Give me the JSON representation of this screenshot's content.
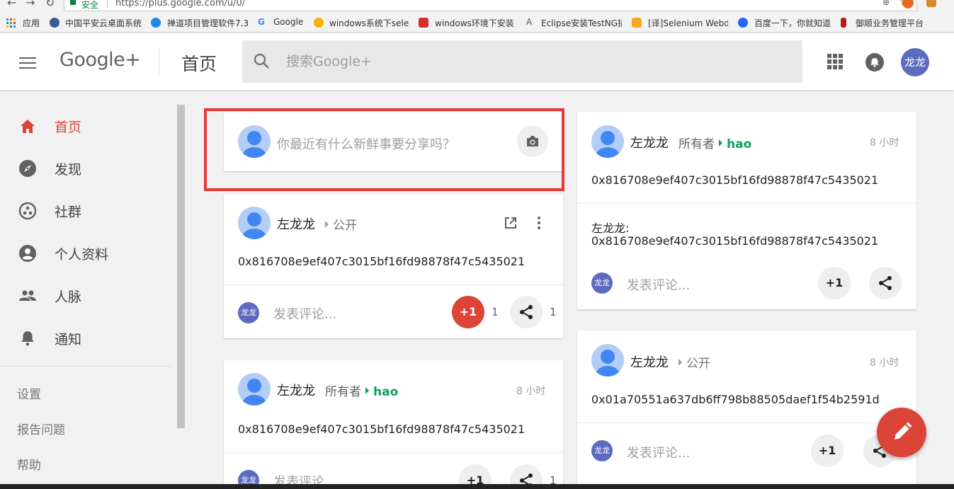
{
  "browser": {
    "secure_label": "安全",
    "url": "https://plus.google.com/u/0/",
    "bookmarks": [
      {
        "label": "应用",
        "color": "#4285f4"
      },
      {
        "label": "中国平安云桌面系统",
        "color": "#3b5998"
      },
      {
        "label": "禅道项目管理软件7.3",
        "color": "#1e88e5"
      },
      {
        "label": "Google",
        "color": "#4285f4"
      },
      {
        "label": "windows系统下selen",
        "color": "#f4b400"
      },
      {
        "label": "windows环境下安装",
        "color": "#d32f2f"
      },
      {
        "label": "Eclipse安装TestNG插",
        "color": "#555555"
      },
      {
        "label": "[译]Selenium Webd",
        "color": "#f9a825"
      },
      {
        "label": "百度一下，你就知道",
        "color": "#2962ff"
      },
      {
        "label": "御顺业务管理平台",
        "color": "#b71c1c"
      }
    ]
  },
  "header": {
    "logo": "Google+",
    "page_title": "首页",
    "search_placeholder": "搜索Google+",
    "avatar_text": "龙龙"
  },
  "sidebar": {
    "items": [
      {
        "label": "首页",
        "icon": "home-icon",
        "active": true
      },
      {
        "label": "发现",
        "icon": "compass-icon"
      },
      {
        "label": "社群",
        "icon": "communities-icon"
      },
      {
        "label": "个人资料",
        "icon": "profile-icon"
      },
      {
        "label": "人脉",
        "icon": "people-icon"
      },
      {
        "label": "通知",
        "icon": "bell-icon"
      }
    ],
    "links": [
      "设置",
      "报告问题",
      "帮助"
    ]
  },
  "compose": {
    "placeholder": "你最近有什么新鲜事要分享吗？"
  },
  "posts": {
    "p1": {
      "author": "左龙龙",
      "audience": "公开",
      "content": "0x816708e9ef407c3015bf16fd98878f47c5435021",
      "comment_placeholder": "发表评论...",
      "avatar_text": "龙龙",
      "plus_label": "+1",
      "plus_count": "1",
      "share_count": "1"
    },
    "p2": {
      "author": "左龙龙",
      "owner_label": "所有者",
      "community": "hao",
      "time": "8 小时",
      "content": "0x816708e9ef407c3015bf16fd98878f47c5435021",
      "comment_placeholder": "发表评论...",
      "avatar_text": "龙龙",
      "plus_label": "+1",
      "share_count": "1"
    },
    "p3": {
      "author": "左龙龙",
      "owner_label": "所有者",
      "community": "hao",
      "time": "8 小时",
      "content": "0x816708e9ef407c3015bf16fd98878f47c5435021",
      "comment_author": "左龙龙:",
      "comment_text": "0x816708e9ef407c3015bf16fd98878f47c5435021",
      "comment_placeholder": "发表评论...",
      "avatar_text": "龙龙",
      "plus_label": "+1"
    },
    "p4": {
      "author": "左龙龙",
      "audience": "公开",
      "time": "8 小时",
      "content": "0x01a70551a637db6ff798b88505daef1f54b2591d",
      "comment_placeholder": "发表评论...",
      "avatar_text": "龙龙",
      "plus_label": "+1"
    }
  },
  "colors": {
    "accent": "#db4437",
    "community": "#0f9d58",
    "avatar": "#5c6bc0"
  }
}
